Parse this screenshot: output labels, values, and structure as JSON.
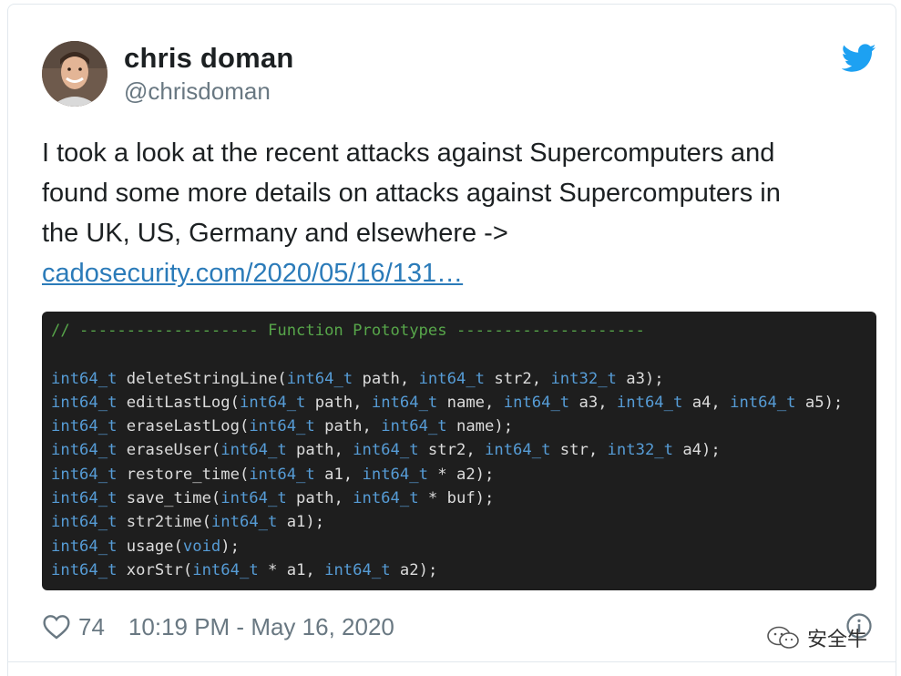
{
  "author": {
    "name": "chris doman",
    "handle": "@chrisdoman"
  },
  "tweet": {
    "lines": [
      "I took a look at the recent attacks against Supercomputers and",
      "found some more details on attacks against Supercomputers in",
      "the UK, US, Germany and elsewhere ->"
    ],
    "link": "cadosecurity.com/2020/05/16/131…"
  },
  "code": {
    "comment": "// ------------------- Function Prototypes --------------------",
    "lines": [
      [
        [
          "kw",
          "int64_t"
        ],
        [
          "plain",
          " deleteStringLine("
        ],
        [
          "kw",
          "int64_t"
        ],
        [
          "plain",
          " path, "
        ],
        [
          "kw",
          "int64_t"
        ],
        [
          "plain",
          " str2, "
        ],
        [
          "kw",
          "int32_t"
        ],
        [
          "plain",
          " a3);"
        ]
      ],
      [
        [
          "kw",
          "int64_t"
        ],
        [
          "plain",
          " editLastLog("
        ],
        [
          "kw",
          "int64_t"
        ],
        [
          "plain",
          " path, "
        ],
        [
          "kw",
          "int64_t"
        ],
        [
          "plain",
          " name, "
        ],
        [
          "kw",
          "int64_t"
        ],
        [
          "plain",
          " a3, "
        ],
        [
          "kw",
          "int64_t"
        ],
        [
          "plain",
          " a4, "
        ],
        [
          "kw",
          "int64_t"
        ],
        [
          "plain",
          " a5);"
        ]
      ],
      [
        [
          "kw",
          "int64_t"
        ],
        [
          "plain",
          " eraseLastLog("
        ],
        [
          "kw",
          "int64_t"
        ],
        [
          "plain",
          " path, "
        ],
        [
          "kw",
          "int64_t"
        ],
        [
          "plain",
          " name);"
        ]
      ],
      [
        [
          "kw",
          "int64_t"
        ],
        [
          "plain",
          " eraseUser("
        ],
        [
          "kw",
          "int64_t"
        ],
        [
          "plain",
          " path, "
        ],
        [
          "kw",
          "int64_t"
        ],
        [
          "plain",
          " str2, "
        ],
        [
          "kw",
          "int64_t"
        ],
        [
          "plain",
          " str, "
        ],
        [
          "kw",
          "int32_t"
        ],
        [
          "plain",
          " a4);"
        ]
      ],
      [
        [
          "kw",
          "int64_t"
        ],
        [
          "plain",
          " restore_time("
        ],
        [
          "kw",
          "int64_t"
        ],
        [
          "plain",
          " a1, "
        ],
        [
          "kw",
          "int64_t"
        ],
        [
          "plain",
          " * a2);"
        ]
      ],
      [
        [
          "kw",
          "int64_t"
        ],
        [
          "plain",
          " save_time("
        ],
        [
          "kw",
          "int64_t"
        ],
        [
          "plain",
          " path, "
        ],
        [
          "kw",
          "int64_t"
        ],
        [
          "plain",
          " * buf);"
        ]
      ],
      [
        [
          "kw",
          "int64_t"
        ],
        [
          "plain",
          " str2time("
        ],
        [
          "kw",
          "int64_t"
        ],
        [
          "plain",
          " a1);"
        ]
      ],
      [
        [
          "kw",
          "int64_t"
        ],
        [
          "plain",
          " usage("
        ],
        [
          "kw",
          "void"
        ],
        [
          "plain",
          ");"
        ]
      ],
      [
        [
          "kw",
          "int64_t"
        ],
        [
          "plain",
          " xorStr("
        ],
        [
          "kw",
          "int64_t"
        ],
        [
          "plain",
          " * a1, "
        ],
        [
          "kw",
          "int64_t"
        ],
        [
          "plain",
          " a2);"
        ]
      ]
    ]
  },
  "footer": {
    "likes": "74",
    "timestamp": "10:19 PM - May 16, 2020"
  },
  "watermark": {
    "text": "安全牛"
  },
  "icons": {
    "brand": "twitter-bird-icon",
    "like": "heart-icon",
    "info": "info-icon",
    "watermark": "wechat-icon"
  },
  "colors": {
    "link": "#2b7bb9",
    "twitter_blue": "#1da1f2",
    "code_bg": "#1e1e1e",
    "code_comment": "#57a64a",
    "code_keyword": "#569cd6",
    "code_text": "#dcdcdc",
    "muted": "#697882"
  }
}
